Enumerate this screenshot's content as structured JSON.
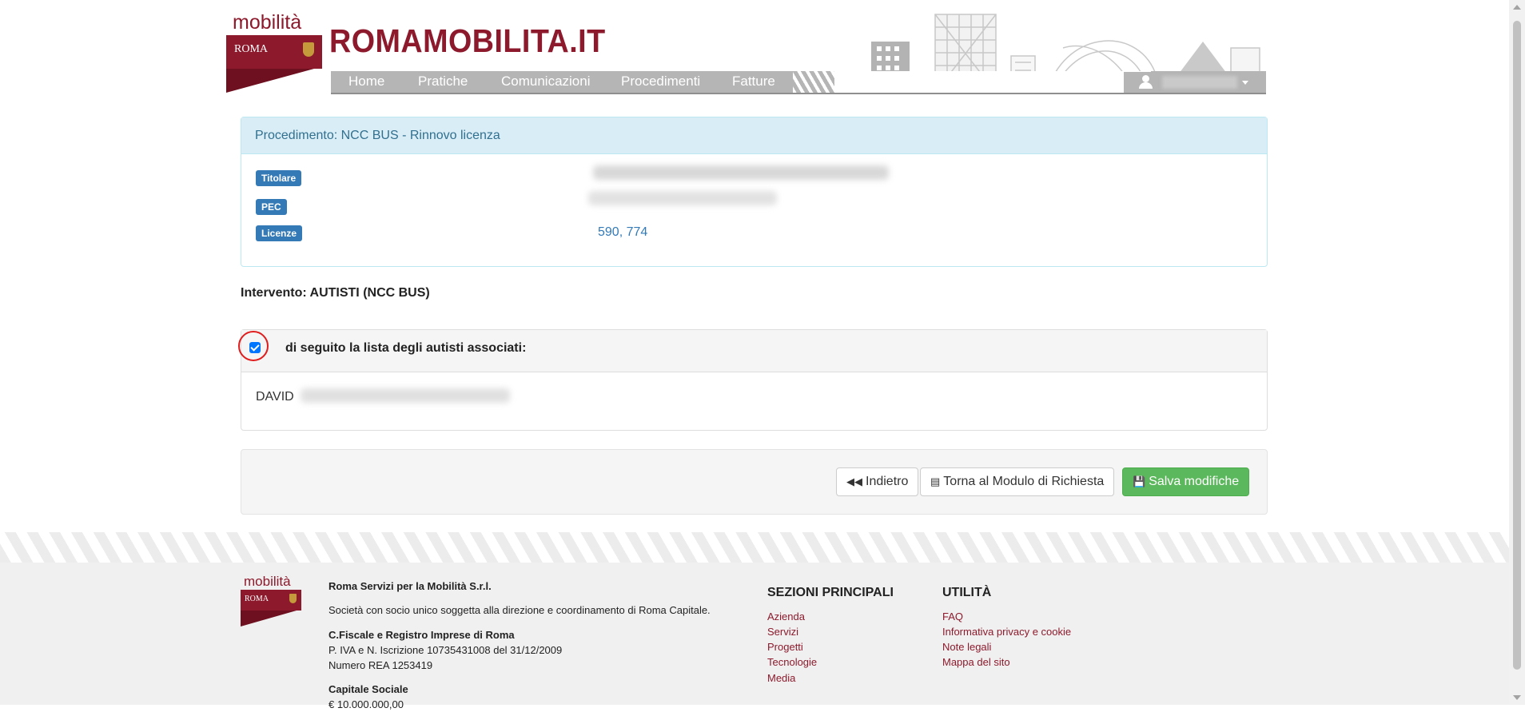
{
  "brand": {
    "logo_word": "mobilità",
    "logo_roma": "ROMA",
    "site_title": "ROMAMOBILITA.IT"
  },
  "nav": {
    "items": [
      "Home",
      "Pratiche",
      "Comunicazioni",
      "Procedimenti",
      "Fatture"
    ]
  },
  "user_menu": {
    "icon": "user-icon",
    "caret_icon": "caret-down-icon"
  },
  "procedimento": {
    "heading": "Procedimento: NCC BUS - Rinnovo licenza",
    "titolare_label": "Titolare",
    "pec_label": "PEC",
    "licenze_label": "Licenze",
    "licenze_value": "590, 774"
  },
  "intervento": {
    "title": "Intervento: AUTISTI (NCC BUS)"
  },
  "autisti": {
    "checkbox_checked": true,
    "label": "di seguito la lista degli autisti associati:",
    "driver_first": "DAVID"
  },
  "actions": {
    "back_label": "Indietro",
    "back_icon": "fast-backward-icon",
    "module_label": "Torna al Modulo di Richiesta",
    "module_icon": "id-card-icon",
    "save_label": "Salva modifiche",
    "save_icon": "floppy-disk-icon",
    "colors": {
      "success": "#5cb85c",
      "primary_label": "#337ab7",
      "brand": "#8c1a2c"
    }
  },
  "footer": {
    "company": "Roma Servizi per la Mobilità S.r.l.",
    "description": "Società con socio unico soggetta alla direzione e coordinamento di Roma Capitale.",
    "fiscal_title": "C.Fiscale e Registro Imprese di Roma",
    "piva": "P. IVA e N. Iscrizione 10735431008 del 31/12/2009",
    "rea": "Numero REA 1253419",
    "capitale_title": "Capitale Sociale",
    "capitale_value": "€ 10.000.000,00",
    "sections_title": "SEZIONI PRINCIPALI",
    "sections": [
      "Azienda",
      "Servizi",
      "Progetti",
      "Tecnologie",
      "Media"
    ],
    "utility_title": "UTILITÀ",
    "utility": [
      "FAQ",
      "Informativa privacy e cookie",
      "Note legali",
      "Mappa del sito"
    ]
  }
}
